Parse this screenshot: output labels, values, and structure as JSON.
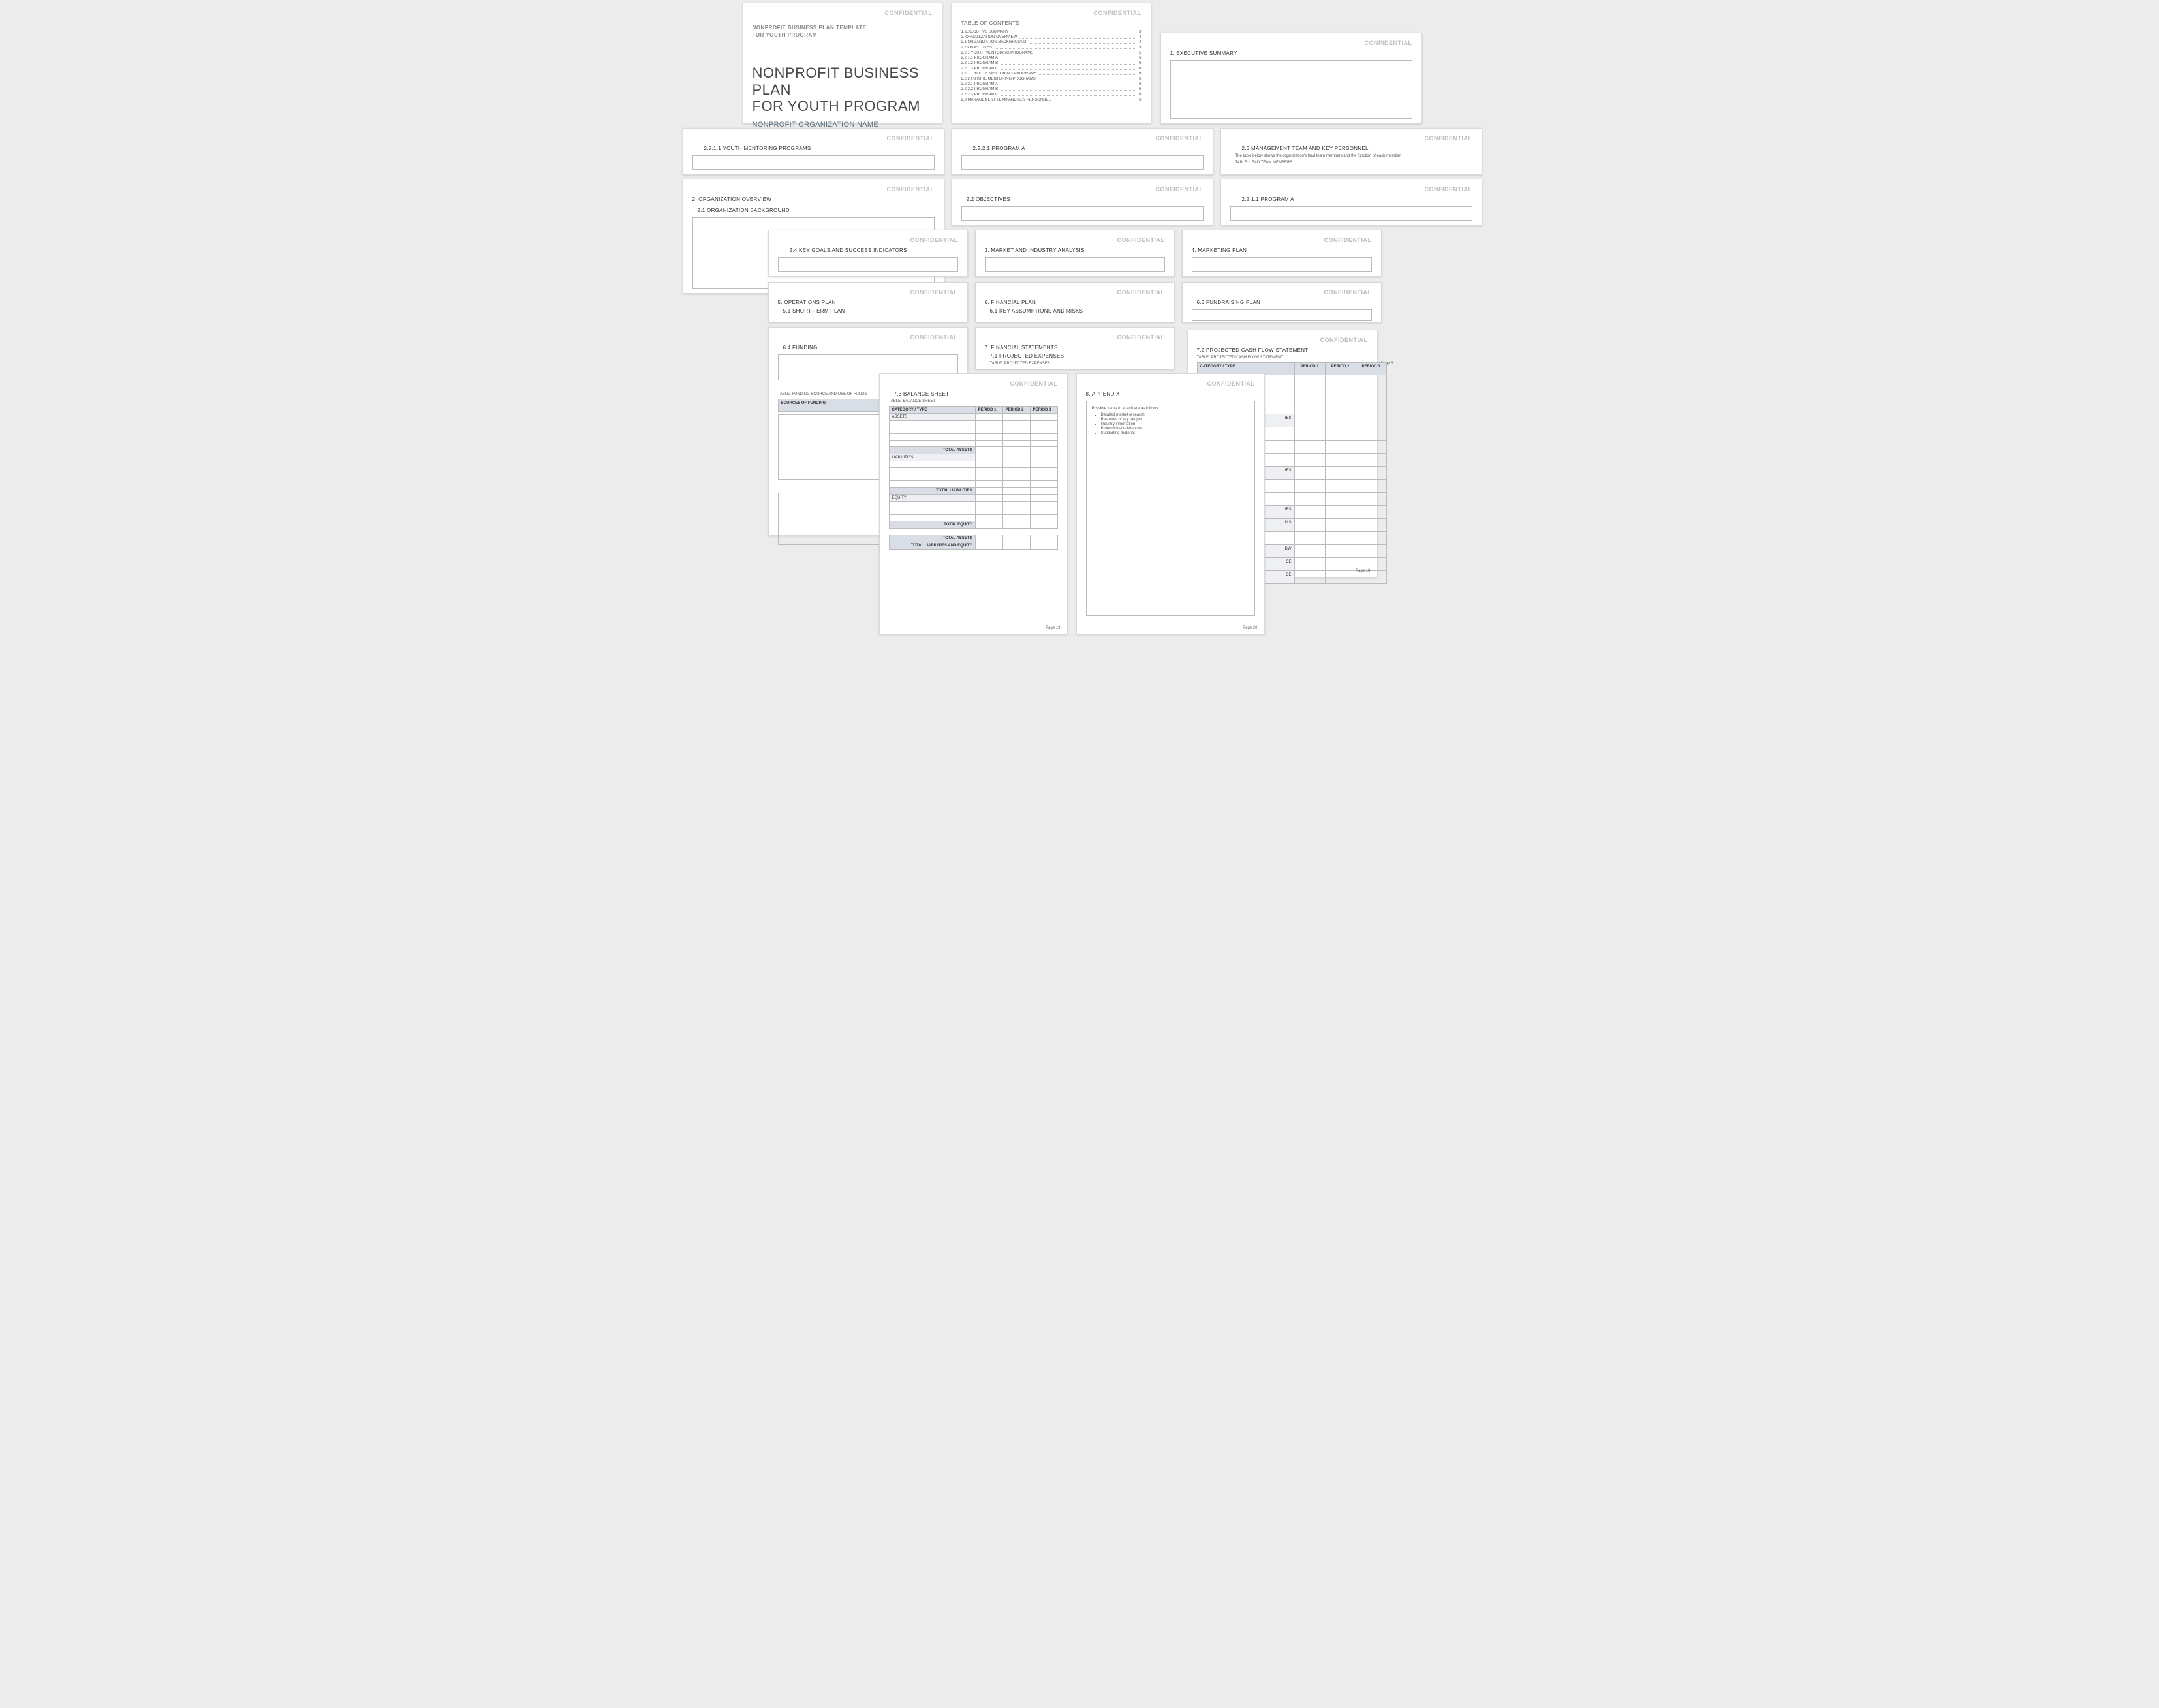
{
  "confidential": "CONFIDENTIAL",
  "cover": {
    "template_line1": "NONPROFIT BUSINESS PLAN TEMPLATE",
    "template_line2": "FOR YOUTH PROGRAM",
    "title_line1": "NONPROFIT BUSINESS PLAN",
    "title_line2": "FOR YOUTH PROGRAM",
    "org_name": "NONPROFIT ORGANIZATION NAME"
  },
  "toc": {
    "title": "TABLE OF CONTENTS",
    "rows": [
      {
        "label": "1.  EXECUTIVE SUMMARY",
        "page": "3"
      },
      {
        "label": "2.  ORGANIZATION OVERVIEW",
        "page": "4"
      },
      {
        "label": "2.1  ORGANIZATION BACKGROUND",
        "page": "4"
      },
      {
        "label": "2.2  OBJECTIVES",
        "page": "5"
      },
      {
        "label": "2.2.1  YOUTH MENTORING PROGRAMS",
        "page": "5"
      },
      {
        "label": "2.2.1.1  PROGRAM A",
        "page": "6"
      },
      {
        "label": "2.2.1.2  PROGRAM B",
        "page": "6"
      },
      {
        "label": "2.2.1.3  PROGRAM C",
        "page": "6"
      },
      {
        "label": "2.2.1.1  YOUTH MENTORING PROGRAMS",
        "page": "6"
      },
      {
        "label": "2.2.2  FUTURE MENTORING PROGRAMS",
        "page": "6"
      },
      {
        "label": "2.2.2.1  PROGRAM A",
        "page": "6"
      },
      {
        "label": "2.2.2.2  PROGRAM B",
        "page": "6"
      },
      {
        "label": "2.2.2.3  PROGRAM C",
        "page": "6"
      },
      {
        "label": "2.3  MANAGEMENT TEAM AND KEY PERSONNEL",
        "page": "6"
      }
    ]
  },
  "pages": {
    "exec": {
      "title": "1. EXECUTIVE SUMMARY"
    },
    "ymp": {
      "title": "2.2.1.1  YOUTH MENTORING PROGRAMS"
    },
    "progA": {
      "title": "2.2.2.1  PROGRAM A"
    },
    "mgmt": {
      "title": "2.3  MANAGEMENT TEAM AND KEY PERSONNEL",
      "note": "The table below shows the organization's lead team members and the function of each member.",
      "table_label": "TABLE:  LEAD TEAM MEMBERS"
    },
    "org": {
      "title": "2. ORGANIZATION OVERVIEW",
      "sub": "2.1  ORGANIZATION BACKGROUND"
    },
    "obj": {
      "title": "2.2  OBJECTIVES"
    },
    "progA2": {
      "title": "2.2.1.1  PROGRAM A"
    },
    "goals": {
      "title": "2.4  KEY GOALS AND SUCCESS INDICATORS"
    },
    "market": {
      "title": "3. MARKET AND INDUSTRY ANALYSIS"
    },
    "mkt_plan": {
      "title": "4. MARKETING PLAN"
    },
    "ops": {
      "title": "5. OPERATIONS PLAN",
      "sub": "5.1  SHORT-TERM PLAN"
    },
    "fin": {
      "title": "6. FINANCIAL PLAN",
      "sub": "6.1  KEY ASSUMPTIONS AND RISKS"
    },
    "fund": {
      "title": "6.3  FUNDRAISING PLAN"
    },
    "funding": {
      "title": "6.4  FUNDING",
      "table_label": "TABLE:  FUNDING SOURCE AND USE OF FUNDS",
      "row_label": "SOURCES OF FUNDING"
    },
    "finstmt": {
      "title": "7. FINANCIAL STATEMENTS",
      "sub": "7.1  PROJECTED EXPENSES",
      "table_label": "TABLE:  PROJECTED EXPENSES"
    },
    "cashflow": {
      "title": "7.2  PROJECTED CASH FLOW STATEMENT",
      "table_label": "TABLE:  PROJECTED CASH FLOW STATEMENT",
      "cols": [
        "CATEGORY / TYPE",
        "PERIOD 1",
        "PERIOD 2",
        "PERIOD 3"
      ],
      "row_groups": [
        "IES",
        "IES",
        "IES",
        "U,S",
        "DW",
        "CE",
        "CE"
      ],
      "page_num": "Page 18",
      "side_num": "Page 6"
    },
    "balance": {
      "title": "7.3  BALANCE SHEET",
      "table_label": "TABLE:  BALANCE SHEET",
      "cols": [
        "CATEGORY / TYPE",
        "PERIOD 1",
        "PERIOD 2",
        "PERIOD 3"
      ],
      "rows": [
        "ASSETS",
        "",
        "",
        "",
        "TOTAL ASSETS",
        "LIABILITIES",
        "",
        "",
        "",
        "TOTAL LIABILITIES",
        "EQUITY",
        "",
        "",
        "",
        "TOTAL EQUITY",
        "TOTAL ASSETS",
        "TOTAL LIABILITIES AND EQUITY"
      ],
      "page_num": "Page 19"
    },
    "appendix": {
      "title": "8. APPENDIX",
      "lead": "Possible items to attach are as follows:",
      "items": [
        "Detailed market research",
        "Resumes of key people",
        "Industry information",
        "Professional references",
        "Supporting material"
      ],
      "page_num": "Page 20"
    }
  }
}
